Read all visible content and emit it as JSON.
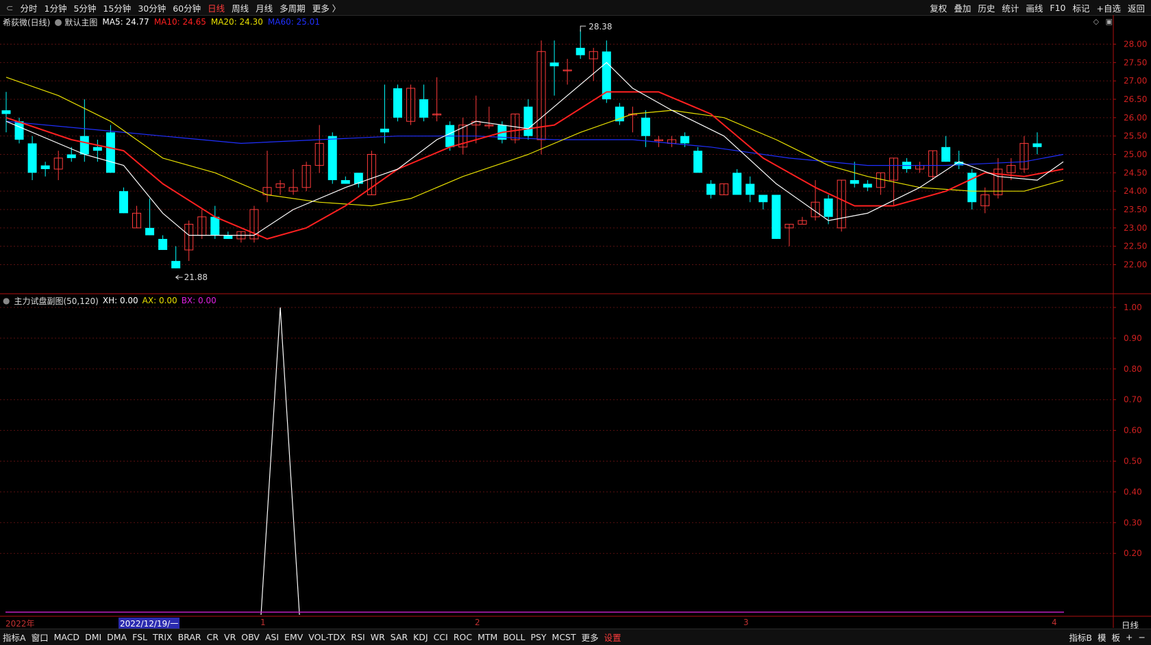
{
  "toolbar": {
    "left_items": [
      {
        "label": "分时",
        "active": false
      },
      {
        "label": "1分钟",
        "active": false
      },
      {
        "label": "5分钟",
        "active": false
      },
      {
        "label": "15分钟",
        "active": false
      },
      {
        "label": "30分钟",
        "active": false
      },
      {
        "label": "60分钟",
        "active": false
      },
      {
        "label": "日线",
        "active": true
      },
      {
        "label": "周线",
        "active": false
      },
      {
        "label": "月线",
        "active": false
      },
      {
        "label": "多周期",
        "active": false
      },
      {
        "label": "更多 〉",
        "active": false
      }
    ],
    "right_items": [
      "复权",
      "叠加",
      "历史",
      "统计",
      "画线",
      "F10",
      "标记",
      "+自选",
      "返回"
    ]
  },
  "legend": {
    "stock": "希荻微(日线)",
    "template": "默认主图",
    "ma5": "MA5: 24.77",
    "ma10": "MA10: 24.65",
    "ma20": "MA20: 24.30",
    "ma60": "MA60: 25.01",
    "colors": {
      "ma5": "#ffffff",
      "ma10": "#ff2020",
      "ma20": "#e8e000",
      "ma60": "#2030ff",
      "up": "#ff3b3b",
      "down": "#00ffff"
    }
  },
  "sublegend": {
    "name": "主力试盘副图(50,120)",
    "xh": "XH: 0.00",
    "ax": "AX: 0.00",
    "bx": "BX: 0.00"
  },
  "annotations": {
    "high": "28.38",
    "low": "21.88"
  },
  "dates": {
    "year": "2022年",
    "selected": "2022/12/19/一",
    "m1": "1",
    "m2": "2",
    "m3": "3",
    "m4": "4"
  },
  "period_label": "日线",
  "bottom": {
    "items": [
      {
        "label": "指标A",
        "red": false
      },
      {
        "label": "窗口",
        "red": false
      },
      {
        "label": "MACD",
        "red": false
      },
      {
        "label": "DMI",
        "red": false
      },
      {
        "label": "DMA",
        "red": false
      },
      {
        "label": "FSL",
        "red": false
      },
      {
        "label": "TRIX",
        "red": false
      },
      {
        "label": "BRAR",
        "red": false
      },
      {
        "label": "CR",
        "red": false
      },
      {
        "label": "VR",
        "red": false
      },
      {
        "label": "OBV",
        "red": false
      },
      {
        "label": "ASI",
        "red": false
      },
      {
        "label": "EMV",
        "red": false
      },
      {
        "label": "VOL-TDX",
        "red": false
      },
      {
        "label": "RSI",
        "red": false
      },
      {
        "label": "WR",
        "red": false
      },
      {
        "label": "SAR",
        "red": false
      },
      {
        "label": "KDJ",
        "red": false
      },
      {
        "label": "CCI",
        "red": false
      },
      {
        "label": "ROC",
        "red": false
      },
      {
        "label": "MTM",
        "red": false
      },
      {
        "label": "BOLL",
        "red": false
      },
      {
        "label": "PSY",
        "red": false
      },
      {
        "label": "MCST",
        "red": false
      },
      {
        "label": "更多",
        "red": false
      },
      {
        "label": "设置",
        "red": true
      }
    ],
    "right": [
      "指标B",
      "模",
      "板",
      "+",
      "−"
    ]
  },
  "chart_data": [
    {
      "type": "candlestick",
      "price_ticks": [
        "28.00",
        "27.50",
        "27.00",
        "26.50",
        "26.00",
        "25.50",
        "25.00",
        "24.50",
        "24.00",
        "23.50",
        "23.00",
        "22.50",
        "22.00"
      ],
      "ylim": [
        21.6,
        28.6
      ],
      "candles": [
        {
          "o": 26.2,
          "h": 26.7,
          "l": 25.6,
          "c": 26.1
        },
        {
          "o": 25.9,
          "h": 26.0,
          "l": 25.3,
          "c": 25.4
        },
        {
          "o": 25.3,
          "h": 25.5,
          "l": 24.3,
          "c": 24.5
        },
        {
          "o": 24.7,
          "h": 24.8,
          "l": 24.4,
          "c": 24.6
        },
        {
          "o": 24.6,
          "h": 25.1,
          "l": 24.3,
          "c": 24.9
        },
        {
          "o": 25.0,
          "h": 25.2,
          "l": 24.8,
          "c": 24.9
        },
        {
          "o": 25.5,
          "h": 26.5,
          "l": 24.8,
          "c": 25.0
        },
        {
          "o": 25.2,
          "h": 25.4,
          "l": 24.8,
          "c": 25.1
        },
        {
          "o": 25.6,
          "h": 25.8,
          "l": 24.5,
          "c": 24.5
        },
        {
          "o": 24.0,
          "h": 24.1,
          "l": 23.4,
          "c": 23.4
        },
        {
          "o": 23.0,
          "h": 23.6,
          "l": 23.0,
          "c": 23.4
        },
        {
          "o": 23.0,
          "h": 23.8,
          "l": 22.8,
          "c": 22.8
        },
        {
          "o": 22.7,
          "h": 22.8,
          "l": 22.4,
          "c": 22.4
        },
        {
          "o": 22.1,
          "h": 22.5,
          "l": 21.9,
          "c": 21.9
        },
        {
          "o": 22.4,
          "h": 23.2,
          "l": 22.1,
          "c": 23.1
        },
        {
          "o": 22.8,
          "h": 23.5,
          "l": 22.7,
          "c": 23.3
        },
        {
          "o": 23.3,
          "h": 23.6,
          "l": 22.7,
          "c": 22.8
        },
        {
          "o": 22.8,
          "h": 22.9,
          "l": 22.7,
          "c": 22.7
        },
        {
          "o": 22.7,
          "h": 22.9,
          "l": 22.6,
          "c": 22.9
        },
        {
          "o": 22.7,
          "h": 23.6,
          "l": 22.6,
          "c": 23.5
        },
        {
          "o": 23.9,
          "h": 25.1,
          "l": 23.7,
          "c": 24.1
        },
        {
          "o": 24.1,
          "h": 24.3,
          "l": 23.9,
          "c": 24.2
        },
        {
          "o": 24.0,
          "h": 24.6,
          "l": 23.9,
          "c": 24.1
        },
        {
          "o": 24.1,
          "h": 24.8,
          "l": 24.0,
          "c": 24.7
        },
        {
          "o": 24.7,
          "h": 25.8,
          "l": 24.5,
          "c": 25.3
        },
        {
          "o": 25.5,
          "h": 25.6,
          "l": 24.2,
          "c": 24.3
        },
        {
          "o": 24.3,
          "h": 24.4,
          "l": 24.2,
          "c": 24.2
        },
        {
          "o": 24.5,
          "h": 24.5,
          "l": 24.1,
          "c": 24.2
        },
        {
          "o": 23.9,
          "h": 25.1,
          "l": 23.9,
          "c": 25.0
        },
        {
          "o": 25.7,
          "h": 26.9,
          "l": 25.3,
          "c": 25.6
        },
        {
          "o": 26.8,
          "h": 26.9,
          "l": 25.9,
          "c": 26.0
        },
        {
          "o": 25.9,
          "h": 26.9,
          "l": 25.8,
          "c": 26.8
        },
        {
          "o": 26.5,
          "h": 26.9,
          "l": 25.9,
          "c": 26.0
        },
        {
          "o": 26.1,
          "h": 27.1,
          "l": 25.9,
          "c": 26.1
        },
        {
          "o": 25.8,
          "h": 25.9,
          "l": 25.1,
          "c": 25.2
        },
        {
          "o": 25.2,
          "h": 26.0,
          "l": 25.0,
          "c": 25.8
        },
        {
          "o": 25.8,
          "h": 26.6,
          "l": 25.3,
          "c": 25.9
        },
        {
          "o": 25.8,
          "h": 26.3,
          "l": 25.7,
          "c": 25.8
        },
        {
          "o": 25.8,
          "h": 25.9,
          "l": 25.3,
          "c": 25.4
        },
        {
          "o": 25.4,
          "h": 26.1,
          "l": 25.3,
          "c": 26.1
        },
        {
          "o": 26.3,
          "h": 26.5,
          "l": 25.4,
          "c": 25.5
        },
        {
          "o": 25.4,
          "h": 28.1,
          "l": 25.0,
          "c": 27.8
        },
        {
          "o": 27.5,
          "h": 28.1,
          "l": 26.6,
          "c": 27.4
        },
        {
          "o": 27.3,
          "h": 27.6,
          "l": 26.9,
          "c": 27.3
        },
        {
          "o": 27.9,
          "h": 28.4,
          "l": 27.6,
          "c": 27.7
        },
        {
          "o": 27.6,
          "h": 27.9,
          "l": 27.0,
          "c": 27.8
        },
        {
          "o": 27.8,
          "h": 28.1,
          "l": 26.4,
          "c": 26.5
        },
        {
          "o": 26.3,
          "h": 26.4,
          "l": 25.8,
          "c": 25.9
        },
        {
          "o": 26.1,
          "h": 26.3,
          "l": 25.6,
          "c": 26.1
        },
        {
          "o": 26.0,
          "h": 26.2,
          "l": 25.2,
          "c": 25.5
        },
        {
          "o": 25.4,
          "h": 25.5,
          "l": 25.2,
          "c": 25.4
        },
        {
          "o": 25.3,
          "h": 25.5,
          "l": 25.2,
          "c": 25.4
        },
        {
          "o": 25.5,
          "h": 25.6,
          "l": 25.2,
          "c": 25.3
        },
        {
          "o": 25.1,
          "h": 25.2,
          "l": 24.5,
          "c": 24.5
        },
        {
          "o": 24.2,
          "h": 24.3,
          "l": 23.8,
          "c": 23.9
        },
        {
          "o": 23.9,
          "h": 24.2,
          "l": 23.9,
          "c": 24.2
        },
        {
          "o": 24.5,
          "h": 24.6,
          "l": 23.9,
          "c": 23.9
        },
        {
          "o": 24.2,
          "h": 24.4,
          "l": 23.7,
          "c": 23.9
        },
        {
          "o": 23.9,
          "h": 23.9,
          "l": 23.5,
          "c": 23.7
        },
        {
          "o": 23.9,
          "h": 23.9,
          "l": 22.7,
          "c": 22.7
        },
        {
          "o": 23.0,
          "h": 23.1,
          "l": 22.5,
          "c": 23.1
        },
        {
          "o": 23.1,
          "h": 23.3,
          "l": 23.1,
          "c": 23.2
        },
        {
          "o": 23.3,
          "h": 24.3,
          "l": 23.2,
          "c": 23.7
        },
        {
          "o": 23.8,
          "h": 23.9,
          "l": 23.1,
          "c": 23.3
        },
        {
          "o": 23.0,
          "h": 24.3,
          "l": 22.9,
          "c": 24.3
        },
        {
          "o": 24.3,
          "h": 24.8,
          "l": 24.1,
          "c": 24.2
        },
        {
          "o": 24.2,
          "h": 24.3,
          "l": 24.0,
          "c": 24.1
        },
        {
          "o": 24.1,
          "h": 24.5,
          "l": 23.9,
          "c": 24.5
        },
        {
          "o": 24.3,
          "h": 24.9,
          "l": 23.6,
          "c": 24.9
        },
        {
          "o": 24.8,
          "h": 24.9,
          "l": 24.5,
          "c": 24.6
        },
        {
          "o": 24.6,
          "h": 24.8,
          "l": 24.5,
          "c": 24.7
        },
        {
          "o": 24.4,
          "h": 25.1,
          "l": 24.3,
          "c": 25.1
        },
        {
          "o": 25.2,
          "h": 25.5,
          "l": 24.8,
          "c": 24.8
        },
        {
          "o": 24.8,
          "h": 25.1,
          "l": 24.6,
          "c": 24.7
        },
        {
          "o": 24.5,
          "h": 24.6,
          "l": 23.5,
          "c": 23.7
        },
        {
          "o": 23.6,
          "h": 24.1,
          "l": 23.4,
          "c": 23.9
        },
        {
          "o": 23.9,
          "h": 24.9,
          "l": 23.8,
          "c": 24.6
        },
        {
          "o": 24.5,
          "h": 24.9,
          "l": 24.3,
          "c": 24.7
        },
        {
          "o": 24.6,
          "h": 25.5,
          "l": 24.5,
          "c": 25.3
        },
        {
          "o": 25.3,
          "h": 25.6,
          "l": 25.0,
          "c": 25.2
        }
      ],
      "ma5_points": [
        [
          0,
          25.9
        ],
        [
          6,
          25.0
        ],
        [
          9,
          24.7
        ],
        [
          12,
          23.4
        ],
        [
          14,
          22.8
        ],
        [
          19,
          22.8
        ],
        [
          22,
          23.5
        ],
        [
          26,
          24.1
        ],
        [
          30,
          24.6
        ],
        [
          33,
          25.4
        ],
        [
          36,
          25.9
        ],
        [
          40,
          25.7
        ],
        [
          43,
          26.6
        ],
        [
          46,
          27.5
        ],
        [
          48,
          26.8
        ],
        [
          51,
          26.2
        ],
        [
          55,
          25.5
        ],
        [
          59,
          24.2
        ],
        [
          63,
          23.2
        ],
        [
          66,
          23.4
        ],
        [
          70,
          24.1
        ],
        [
          73,
          24.8
        ],
        [
          76,
          24.4
        ],
        [
          79,
          24.3
        ],
        [
          81,
          24.8
        ]
      ],
      "ma10_points": [
        [
          0,
          26.0
        ],
        [
          5,
          25.4
        ],
        [
          9,
          25.1
        ],
        [
          12,
          24.2
        ],
        [
          16,
          23.3
        ],
        [
          20,
          22.7
        ],
        [
          23,
          23.0
        ],
        [
          26,
          23.6
        ],
        [
          30,
          24.6
        ],
        [
          34,
          25.2
        ],
        [
          38,
          25.6
        ],
        [
          42,
          25.8
        ],
        [
          46,
          26.7
        ],
        [
          50,
          26.7
        ],
        [
          54,
          26.1
        ],
        [
          58,
          24.9
        ],
        [
          62,
          24.1
        ],
        [
          65,
          23.6
        ],
        [
          68,
          23.6
        ],
        [
          72,
          24.0
        ],
        [
          75,
          24.5
        ],
        [
          78,
          24.4
        ],
        [
          81,
          24.6
        ]
      ],
      "ma20_points": [
        [
          0,
          27.1
        ],
        [
          4,
          26.6
        ],
        [
          8,
          25.9
        ],
        [
          12,
          24.9
        ],
        [
          16,
          24.5
        ],
        [
          20,
          23.9
        ],
        [
          24,
          23.7
        ],
        [
          28,
          23.6
        ],
        [
          31,
          23.8
        ],
        [
          35,
          24.4
        ],
        [
          40,
          25.0
        ],
        [
          44,
          25.6
        ],
        [
          48,
          26.1
        ],
        [
          51,
          26.2
        ],
        [
          55,
          26.0
        ],
        [
          59,
          25.4
        ],
        [
          63,
          24.7
        ],
        [
          66,
          24.4
        ],
        [
          70,
          24.1
        ],
        [
          74,
          24.0
        ],
        [
          78,
          24.0
        ],
        [
          81,
          24.3
        ]
      ],
      "ma60_points": [
        [
          0,
          25.9
        ],
        [
          6,
          25.7
        ],
        [
          12,
          25.5
        ],
        [
          18,
          25.3
        ],
        [
          24,
          25.4
        ],
        [
          30,
          25.5
        ],
        [
          36,
          25.5
        ],
        [
          42,
          25.4
        ],
        [
          48,
          25.4
        ],
        [
          54,
          25.2
        ],
        [
          60,
          24.9
        ],
        [
          66,
          24.7
        ],
        [
          72,
          24.7
        ],
        [
          78,
          24.8
        ],
        [
          81,
          25.0
        ]
      ]
    },
    {
      "type": "line",
      "title": "主力试盘副图(50,120)",
      "yticks": [
        "1.00",
        "0.90",
        "0.80",
        "0.70",
        "0.60",
        "0.50",
        "0.40",
        "0.30",
        "0.20"
      ],
      "ylim": [
        0,
        1
      ],
      "xh_series": [
        [
          20,
          0
        ],
        [
          21,
          1.0
        ],
        [
          22,
          0
        ]
      ],
      "bx_value": 0
    }
  ]
}
